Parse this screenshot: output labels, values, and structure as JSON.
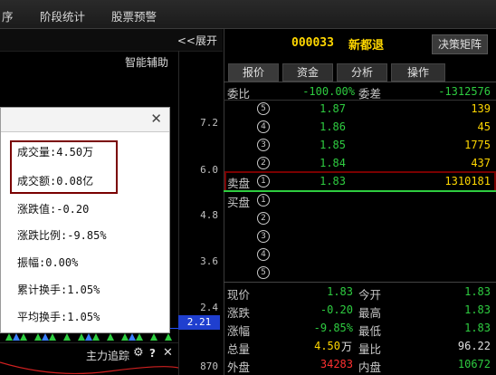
{
  "menu": {
    "items": [
      "序",
      "阶段统计",
      "股票预警"
    ]
  },
  "chart": {
    "expand_label": "<<展开",
    "assist_label": "智能辅助",
    "y_ticks": [
      "7.2",
      "6.0",
      "4.8",
      "3.6",
      "2.4",
      "870"
    ],
    "current_price_tag": "2.21",
    "footer_label": "主力追踪",
    "footer_icons": [
      "gear-icon",
      "help-icon",
      "close-icon"
    ]
  },
  "popup": {
    "items": [
      "成交量:4.50万",
      "成交额:0.08亿",
      "涨跌值:-0.20",
      "涨跌比例:-9.85%",
      "振幅:0.00%",
      "累计换手:1.05%",
      "平均换手:1.05%"
    ]
  },
  "stock": {
    "code": "000033",
    "name": "新都退",
    "decision_button": "决策矩阵",
    "tabs": [
      "报价",
      "资金",
      "分析",
      "操作"
    ]
  },
  "quote": {
    "weibi_label": "委比",
    "weibi_value": "-100.00%",
    "weicha_label": "委差",
    "weicha_value": "-1312576",
    "sell_label": "卖盘",
    "buy_label": "买盘",
    "sell": [
      {
        "level": "5",
        "price": "1.87",
        "vol": "139"
      },
      {
        "level": "4",
        "price": "1.86",
        "vol": "45"
      },
      {
        "level": "3",
        "price": "1.85",
        "vol": "1775"
      },
      {
        "level": "2",
        "price": "1.84",
        "vol": "437"
      },
      {
        "level": "1",
        "price": "1.83",
        "vol": "1310181"
      }
    ],
    "buy_levels": [
      "1",
      "2",
      "3",
      "4",
      "5"
    ]
  },
  "stats": [
    {
      "l1": "现价",
      "v1": "1.83",
      "l2": "今开",
      "v2": "1.83"
    },
    {
      "l1": "涨跌",
      "v1": "-0.20",
      "l2": "最高",
      "v2": "1.83"
    },
    {
      "l1": "涨幅",
      "v1": "-9.85%",
      "l2": "最低",
      "v2": "1.83"
    },
    {
      "l1": "总量",
      "v1": "4.50",
      "v1_unit": "万",
      "l2": "量比",
      "v2": "96.22"
    },
    {
      "l1": "外盘",
      "v1": "34283",
      "l2": "内盘",
      "v2": "10672"
    }
  ],
  "colors": {
    "up": "#ff3030",
    "down": "#2ecc40",
    "accent": "#ffd700",
    "highlight_box": "#7a0000"
  }
}
